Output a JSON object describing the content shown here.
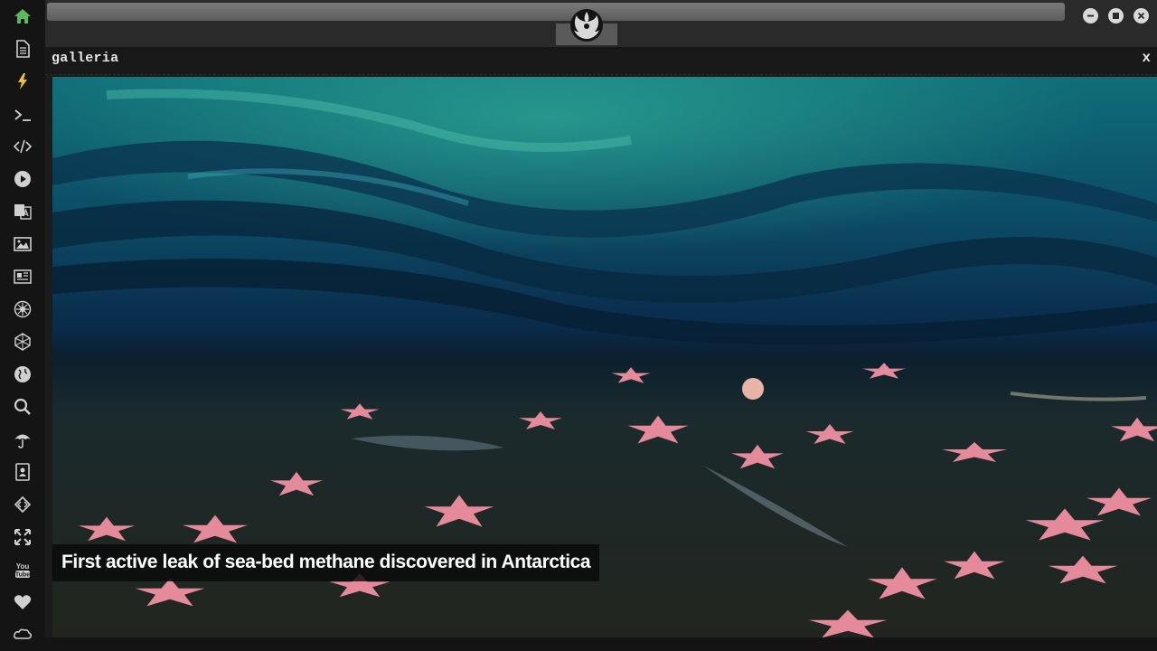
{
  "sidebar": {
    "items": [
      {
        "name": "home-icon",
        "active": true
      },
      {
        "name": "document-icon"
      },
      {
        "name": "lightning-icon"
      },
      {
        "name": "terminal-icon"
      },
      {
        "name": "code-icon"
      },
      {
        "name": "play-icon"
      },
      {
        "name": "translate-icon"
      },
      {
        "name": "image-icon"
      },
      {
        "name": "newspaper-icon"
      },
      {
        "name": "rebel-icon"
      },
      {
        "name": "hexagon-icon"
      },
      {
        "name": "globe-icon"
      },
      {
        "name": "search-icon"
      },
      {
        "name": "umbrella-icon"
      },
      {
        "name": "contact-icon"
      },
      {
        "name": "diamond-code-icon"
      },
      {
        "name": "expand-icon"
      },
      {
        "name": "youtube-icon"
      },
      {
        "name": "heart-icon"
      },
      {
        "name": "infinity-cloud-icon"
      }
    ],
    "colors": {
      "icon": "#d0d0d0",
      "active": "#5cb85c",
      "lightning": "#f0c040"
    }
  },
  "window": {
    "logo": "rebel-alliance-icon"
  },
  "panel": {
    "title": "galleria",
    "close_label": "x"
  },
  "gallery": {
    "caption": "First active leak of sea-bed methane discovered in Antarctica"
  }
}
